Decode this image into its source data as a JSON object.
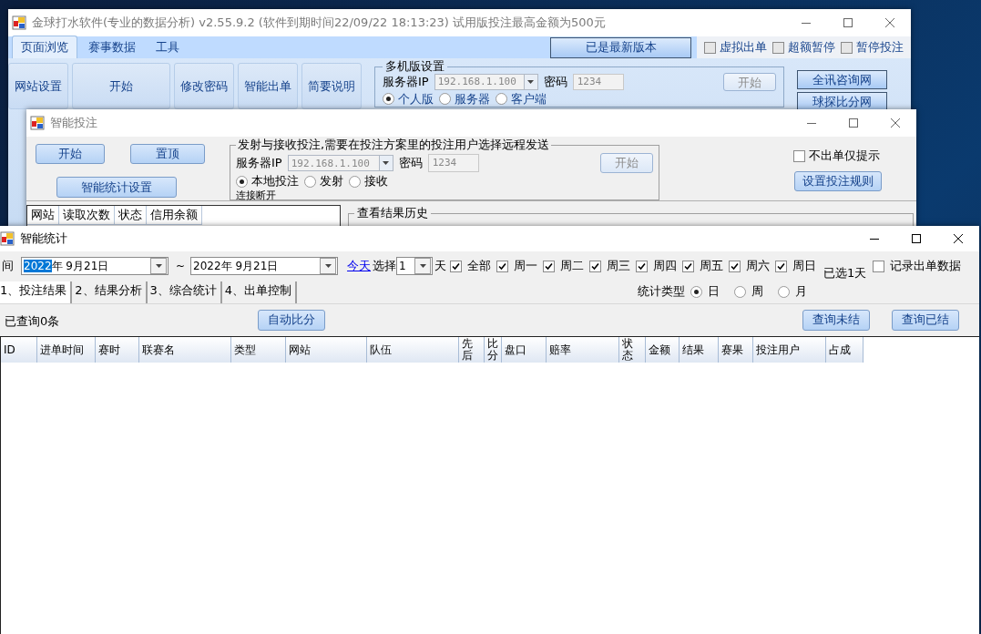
{
  "main_window": {
    "title": "金球打水软件(专业的数据分析) v2.55.9.2 (软件到期时间22/09/22 18:13:23) 试用版投注最高金额为500元",
    "menu_tabs": [
      {
        "label": "页面浏览",
        "selected": true
      },
      {
        "label": "赛事数据",
        "selected": false
      },
      {
        "label": "工具",
        "selected": false
      }
    ],
    "update_button": "已是最新版本",
    "options": [
      {
        "label": "虚拟出单",
        "checked": false
      },
      {
        "label": "超额暂停",
        "checked": false
      },
      {
        "label": "暂停投注",
        "checked": false
      }
    ],
    "toolbar_buttons": [
      "网站设置",
      "开始",
      "修改密码",
      "智能出单",
      "简要说明"
    ],
    "multi_machine": {
      "legend": "多机版设置",
      "server_ip_label": "服务器IP",
      "server_ip": "192.168.1.100",
      "password_label": "密码",
      "password": "1234",
      "start_button": {
        "label": "开始",
        "disabled": true
      },
      "modes": [
        {
          "label": "个人版",
          "selected": true
        },
        {
          "label": "服务器",
          "selected": false
        },
        {
          "label": "客户端",
          "selected": false
        }
      ]
    },
    "links": [
      "全讯咨询网",
      "球探比分网"
    ]
  },
  "bet_window": {
    "title": "智能投注",
    "buttons": [
      "开始",
      "置顶"
    ],
    "settings_button": "智能统计设置",
    "transfer": {
      "legend": "发射与接收投注,需要在投注方案里的投注用户选择远程发送",
      "server_ip_label": "服务器IP",
      "server_ip": "192.168.1.100",
      "password_label": "密码",
      "password": "1234",
      "start_button": {
        "label": "开始",
        "disabled": true
      },
      "modes": [
        {
          "label": "本地投注",
          "selected": true
        },
        {
          "label": "发射",
          "selected": false
        },
        {
          "label": "接收",
          "selected": false
        }
      ],
      "status": "连接断开"
    },
    "notify_only": {
      "label": "不出单仅提示",
      "checked": false
    },
    "rules_button": "设置投注规则",
    "site_columns": [
      "网站",
      "读取次数",
      "状态",
      "信用余额"
    ],
    "history_legend": "查看结果历史"
  },
  "stats_window": {
    "title": "智能统计",
    "time_label": "间",
    "date_from": {
      "highlighted": "2022",
      "rest": "年  9月21日"
    },
    "range_sep": "~",
    "date_to": "2022年  9月21日",
    "today_link": "今天",
    "choose_label": "选择",
    "days_value": "1",
    "days_unit": "天",
    "weekdays": [
      {
        "label": "全部",
        "checked": true
      },
      {
        "label": "周一",
        "checked": true
      },
      {
        "label": "周二",
        "checked": true
      },
      {
        "label": "周三",
        "checked": true
      },
      {
        "label": "周四",
        "checked": true
      },
      {
        "label": "周五",
        "checked": true
      },
      {
        "label": "周六",
        "checked": true
      },
      {
        "label": "周日",
        "checked": true
      }
    ],
    "selected_days": "已选1天",
    "record_option": {
      "label": "记录出单数据",
      "checked": false
    },
    "tabs": [
      {
        "label": "1、投注结果",
        "selected": true
      },
      {
        "label": "2、结果分析",
        "selected": false
      },
      {
        "label": "3、综合统计",
        "selected": false
      },
      {
        "label": "4、出单控制",
        "selected": false
      }
    ],
    "stat_type_label": "统计类型",
    "stat_types": [
      {
        "label": "日",
        "selected": true
      },
      {
        "label": "周",
        "selected": false
      },
      {
        "label": "月",
        "selected": false
      }
    ],
    "query_count": "已查询0条",
    "auto_score_button": "自动比分",
    "query_buttons": [
      "查询未结",
      "查询已结"
    ],
    "table": {
      "columns": [
        "ID",
        "进单时间",
        "赛时",
        "联赛名",
        "类型",
        "网站",
        "队伍",
        "先后",
        "比分",
        "盘口",
        "赔率",
        "状态",
        "金额",
        "结果",
        "赛果",
        "投注用户",
        "占成"
      ]
    }
  }
}
